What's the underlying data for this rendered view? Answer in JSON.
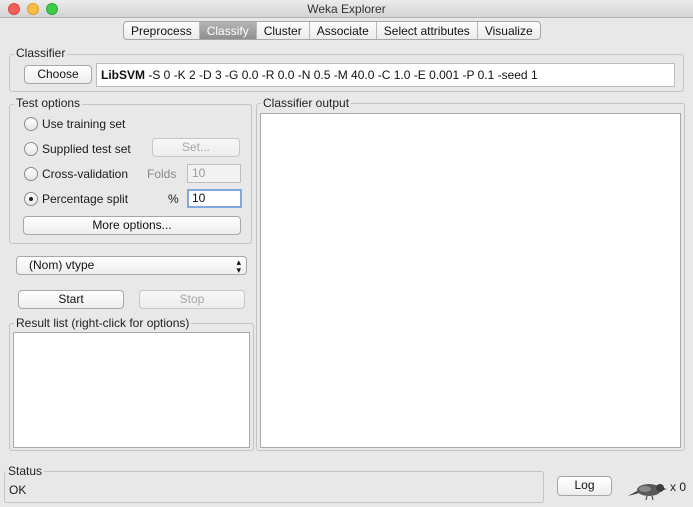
{
  "window": {
    "title": "Weka Explorer"
  },
  "tabs": [
    "Preprocess",
    "Classify",
    "Cluster",
    "Associate",
    "Select attributes",
    "Visualize"
  ],
  "selected_tab": "Classify",
  "classifier": {
    "group_label": "Classifier",
    "choose_label": "Choose",
    "name": "LibSVM",
    "options": "-S 0 -K 2 -D 3 -G 0.0 -R 0.0 -N 0.5 -M 40.0 -C 1.0 -E 0.001 -P 0.1 -seed 1"
  },
  "test_options": {
    "group_label": "Test options",
    "use_training_set": "Use training set",
    "supplied_test_set": "Supplied test set",
    "set_button": "Set...",
    "cross_validation": "Cross-validation",
    "folds_label": "Folds",
    "folds_value": "10",
    "percentage_split": "Percentage split",
    "percent_label": "%",
    "percent_value": "10",
    "selected": "percentage_split",
    "more_options": "More options..."
  },
  "class_attribute": {
    "value": "(Nom) vtype"
  },
  "actions": {
    "start": "Start",
    "stop": "Stop"
  },
  "result_list": {
    "label": "Result list (right-click for options)"
  },
  "output": {
    "label": "Classifier output"
  },
  "status": {
    "label": "Status",
    "text": "OK",
    "log_button": "Log",
    "task_count": "x 0"
  },
  "icons": {
    "status_icon": "weka-bird-icon",
    "combo_arrow": "updown-arrows-icon"
  }
}
